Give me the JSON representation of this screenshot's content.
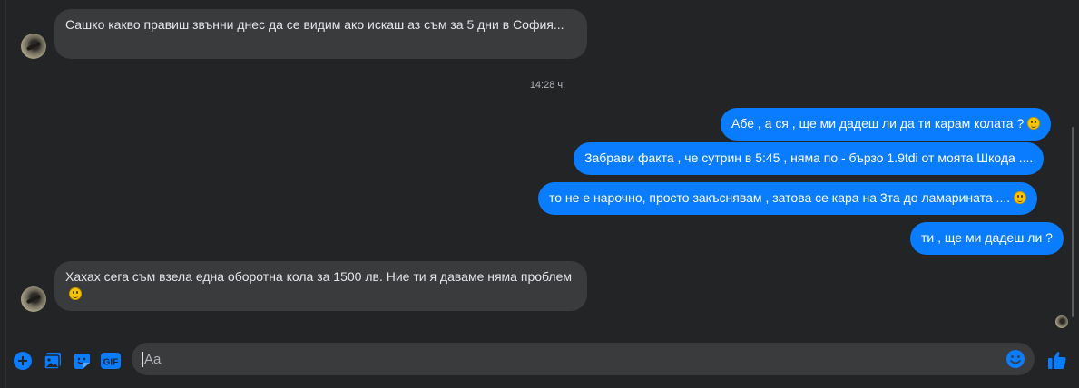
{
  "messages": {
    "incoming_1": "Сашко какво правиш звънни днес да се видим ако искаш аз съм за 5 дни в София...",
    "timestamp": "14:28 ч.",
    "outgoing_1": "Абе , а ся , ще ми дадеш ли да ти карам колата ?",
    "outgoing_2": "Забрави факта , че сутрин в 5:45 , няма по - бързо 1.9tdi от моята Шкода ....",
    "outgoing_3": "то не е нарочно, просто закъснявам , затова се кара на 3та до ламарината ....",
    "outgoing_4": "ти , ще ми дадеш ли ?",
    "incoming_2": "Хахах сега съм взела една оборотна кола за 1500 лв. Ние ти я даваме няма проблем"
  },
  "composer": {
    "placeholder": "Aa",
    "gif_label": "GIF"
  },
  "colors": {
    "accent": "#0a7cff",
    "incoming_bubble": "#3a3b3c",
    "background": "#232426"
  }
}
